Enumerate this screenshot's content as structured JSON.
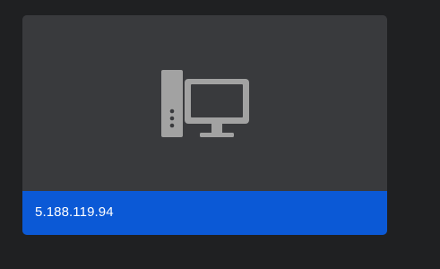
{
  "host": {
    "address": "5.188.119.94",
    "icon": "desktop-computer-icon"
  },
  "colors": {
    "background": "#1f2022",
    "card": "#393a3d",
    "footer": "#0b59d6",
    "icon": "#a2a2a2",
    "text": "#ffffff"
  }
}
